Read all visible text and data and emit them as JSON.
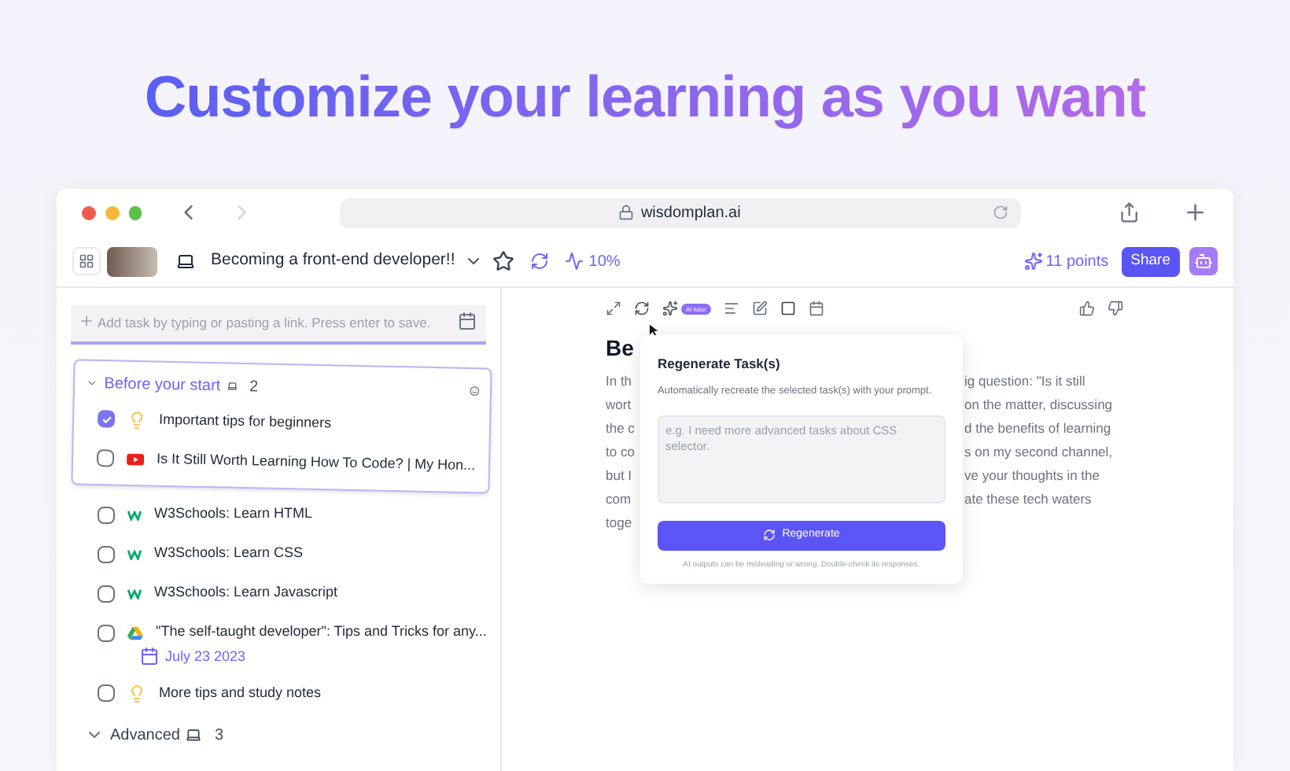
{
  "headline": "Customize your learning as you want",
  "browser": {
    "url": "wisdomplan.ai"
  },
  "header": {
    "plan_title": "Becoming a front-end developer!!",
    "progress": "10%",
    "points": "11 points",
    "share": "Share"
  },
  "add_task": {
    "placeholder": "Add task by typing or pasting a link. Press enter to save."
  },
  "groups": [
    {
      "title": "Before your start",
      "count": "2",
      "expanded": true,
      "dragging": true,
      "tasks": [
        {
          "kind": "tip",
          "title": "Important tips for beginners",
          "checked": true
        },
        {
          "kind": "video",
          "title": "Is It Still Worth Learning How To Code? | My Hon...",
          "checked": false
        }
      ]
    },
    {
      "dragging": false,
      "tasks": [
        {
          "kind": "w3",
          "title": "W3Schools: Learn HTML",
          "checked": false
        },
        {
          "kind": "w3",
          "title": "W3Schools: Learn CSS",
          "checked": false
        },
        {
          "kind": "w3",
          "title": "W3Schools: Learn Javascript",
          "checked": false
        },
        {
          "kind": "drive",
          "title": "\"The self-taught developer\": Tips and Tricks for any...",
          "checked": false,
          "date": "July 23 2023"
        },
        {
          "kind": "tip",
          "title": "More tips and study notes",
          "checked": false
        }
      ]
    },
    {
      "title": "Advanced",
      "count": "3",
      "expanded": true,
      "dragging": false
    }
  ],
  "detail": {
    "ai_badge": "AI tutor",
    "title": "Be",
    "left_fragments": [
      "In th",
      "wort",
      "the c",
      "to co",
      "but I",
      "com",
      "toge"
    ],
    "right_fragments": [
      "ig question: \"Is it still",
      "on the matter, discussing",
      "d the benefits of learning",
      "s on my second channel,",
      "ve your thoughts in the",
      "ate these tech waters"
    ]
  },
  "popup": {
    "title": "Regenerate Task(s)",
    "description": "Automatically recreate the selected task(s) with your prompt.",
    "placeholder": "e.g. I need more advanced tasks about CSS selector.",
    "button": "Regenerate",
    "disclaimer": "AI outputs can be misleading or wrong. Double-check its responses."
  }
}
